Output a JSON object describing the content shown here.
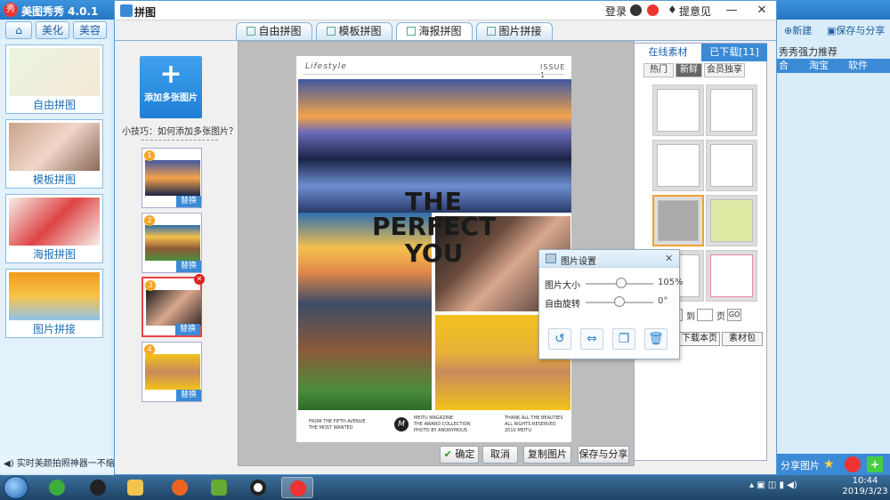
{
  "app": {
    "title": "美图秀秀 4.0.1",
    "nav_tabs": [
      "美化",
      "美容"
    ],
    "left_panel_items": [
      "自由拼图",
      "模板拼图",
      "海报拼图",
      "图片拼接"
    ],
    "status_text": "实时美颜拍照神器一不缩图",
    "right_new": "新建",
    "right_save_share": "保存与分享",
    "right_recommend": "秀秀强力推荐",
    "right_tabs": [
      "合",
      "淘宝",
      "软件"
    ],
    "right_share": "分享图片"
  },
  "dialog": {
    "title": "拼图",
    "login": "登录",
    "feedback": "提意见",
    "tabs": [
      {
        "label": "自由拼图",
        "active": false
      },
      {
        "label": "模板拼图",
        "active": false
      },
      {
        "label": "海报拼图",
        "active": true
      },
      {
        "label": "图片拼接",
        "active": false
      }
    ],
    "add_images_label": "添加多张图片",
    "tip": "小技巧：如何添加多张图片？",
    "slots": [
      {
        "num": "1",
        "replace": "替换",
        "selected": false
      },
      {
        "num": "2",
        "replace": "替换",
        "selected": false
      },
      {
        "num": "3",
        "replace": "替换",
        "selected": true
      },
      {
        "num": "4",
        "replace": "替换",
        "selected": false
      }
    ],
    "buttons": {
      "confirm": "确定",
      "cancel": "取消",
      "copy": "复制图片",
      "save_share": "保存与分享"
    }
  },
  "poster": {
    "section": "Lifestyle",
    "issue": "ISSUE 1",
    "headline": [
      "THE",
      "PERFECT",
      "YOU"
    ],
    "footer_left": [
      "FROM THE FIFTH AVENUE",
      "THE MOST WANTED"
    ],
    "logo": "M",
    "footer_mid": [
      "MEITU MAGAZINE",
      "THE AWARD COLLECTION",
      "PHOTO BY ANONYMOUS"
    ],
    "footer_right": [
      "THANK ALL THE BEAUTIES",
      "ALL RIGHTS RESERVED",
      "2010 MEITU"
    ]
  },
  "materials": {
    "tab_online": "在线素材",
    "tab_downloaded": "已下载[11]",
    "subtabs": [
      "热门",
      "新鲜",
      "会员独享"
    ],
    "active_subtab": "新鲜",
    "page_to": "到",
    "page_unit": "页",
    "go": "GO",
    "download_page": "下载本页",
    "material_pack": "素材包"
  },
  "photo_settings": {
    "title": "图片设置",
    "size_label": "图片大小",
    "size_value": "105%",
    "size_level": 0.52,
    "rotate_label": "自由旋转",
    "rotate_value": "0°",
    "rotate_level": 0.5
  },
  "taskbar": {
    "time": "10:44",
    "date": "2019/3/23"
  },
  "colors": {
    "accent": "#3b8ad6",
    "title_bar": "#2676c4"
  }
}
